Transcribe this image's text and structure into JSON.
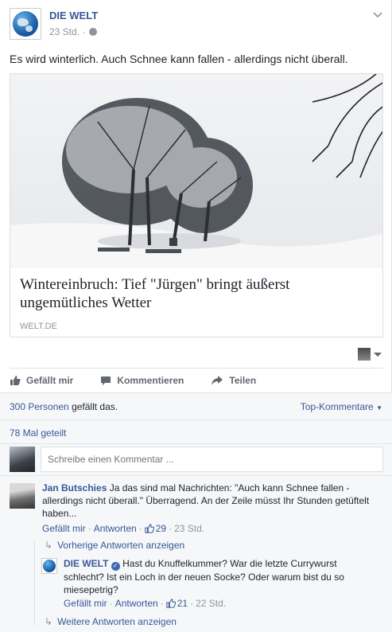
{
  "post": {
    "page_name": "DIE WELT",
    "time": "23 Std.",
    "meta_sep": "·",
    "text": "Es wird winterlich. Auch Schnee kann fallen - allerdings nicht überall.",
    "link": {
      "title": "Wintereinbruch: Tief \"Jürgen\" bringt äußerst ungemütliches Wetter",
      "domain": "WELT.DE"
    }
  },
  "actions": {
    "like": "Gefällt mir",
    "comment": "Kommentieren",
    "share": "Teilen"
  },
  "stats": {
    "likes_link": "300 Personen",
    "likes_rest": " gefällt das.",
    "sort": "Top-Kommentare",
    "shares": "78 Mal geteilt"
  },
  "composer": {
    "placeholder": "Schreibe einen Kommentar ..."
  },
  "comments": [
    {
      "author": "Jan Butschies",
      "text": " Ja das sind mal Nachrichten: \"Auch kann Schnee fallen - allerdings nicht überall.\" Überragend. An der Zeile müsst Ihr Stunden getüftelt haben...",
      "like_label": "Gefällt mir",
      "reply_label": "Antworten",
      "likes": "29",
      "time": "23 Std."
    }
  ],
  "replies": {
    "prev_label": "Vorherige Antworten anzeigen",
    "more_label": "Weitere Antworten anzeigen",
    "items": [
      {
        "author": "DIE WELT",
        "text": " Hast du Knuffelkummer? War die letzte Currywurst schlecht? Ist ein Loch in der neuen Socke? Oder warum bist du so miesepetrig?",
        "like_label": "Gefällt mir",
        "reply_label": "Antworten",
        "likes": "21",
        "time": "22 Std."
      }
    ]
  },
  "colors": {
    "link_blue": "#365899",
    "muted": "#90949c",
    "verified": "#4267b2"
  },
  "icons": [
    "globe-logo",
    "chevron-down-icon",
    "thumbs-up-icon",
    "comment-icon",
    "share-icon",
    "verified-icon",
    "reply-arrow-icon"
  ]
}
